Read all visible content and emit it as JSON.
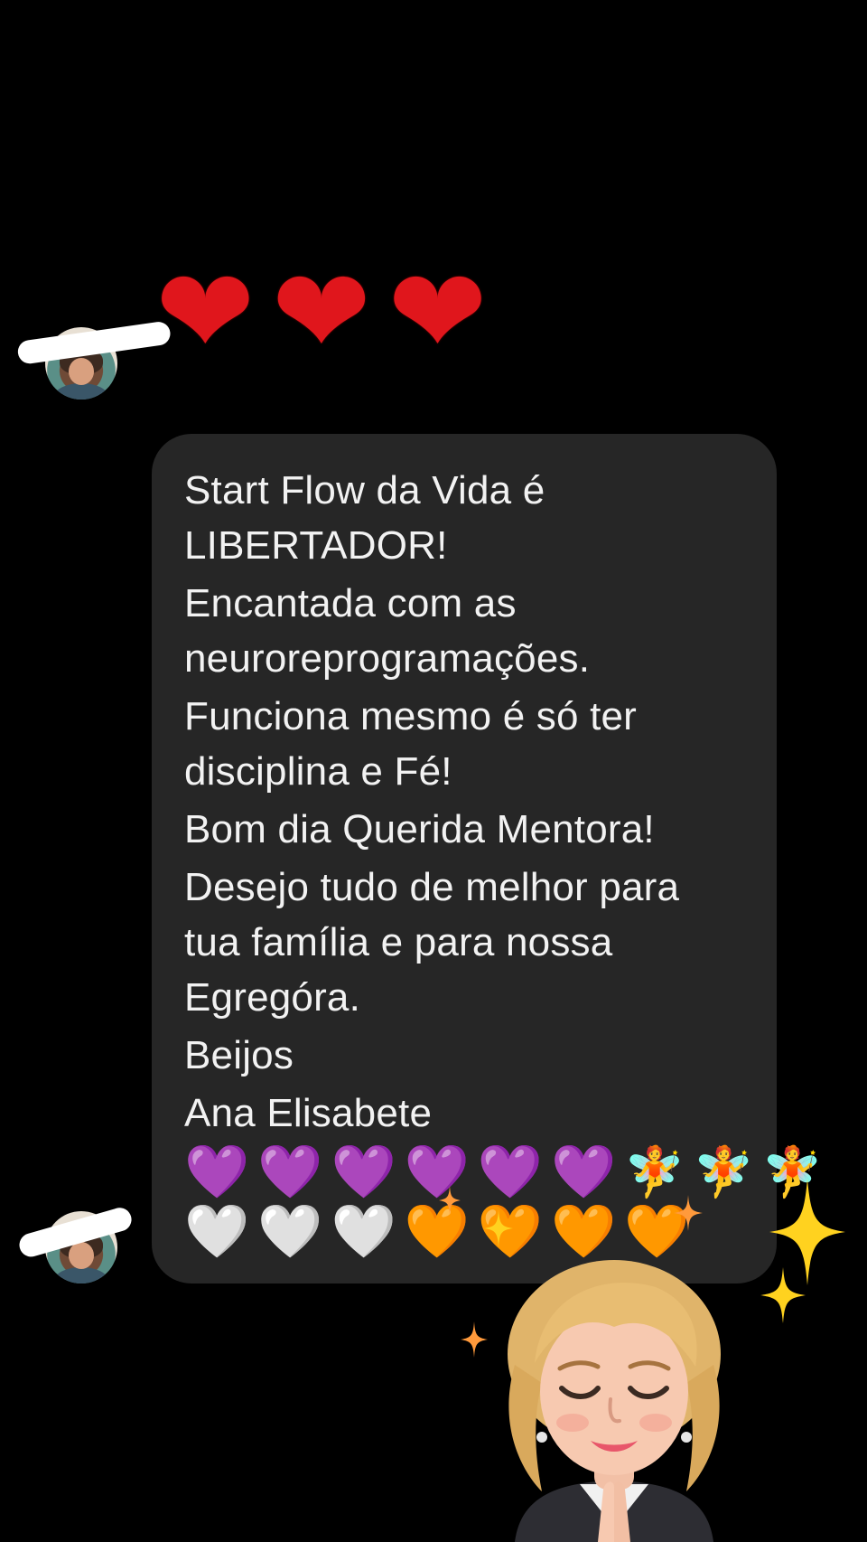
{
  "reaction": {
    "emoji": [
      "heart-icon",
      "heart-icon",
      "heart-icon"
    ],
    "glyph": "❤"
  },
  "message": {
    "paragraphs": [
      "Start Flow da Vida é\nLIBERTADOR!",
      "Encantada com as\nneuroreprogramações.",
      "Funciona mesmo é só ter\ndisciplina e Fé!",
      "Bom dia Querida Mentora!",
      "Desejo tudo de melhor para\ntua família e para nossa\nEgregóra.",
      "Beijos",
      "Ana Elisabete"
    ],
    "emoji_row_1": [
      "💜",
      "💜",
      "💜",
      "💜",
      "💜",
      "💜",
      "🧚",
      "🧚",
      "🧚"
    ],
    "emoji_row_2": [
      "🤍",
      "🤍",
      "🤍",
      "🧡",
      "🧡",
      "🧡",
      "🧡"
    ]
  },
  "colors": {
    "background": "#000000",
    "bubble": "#262626",
    "text": "#f2f2f2",
    "reaction_heart": "#e0161c",
    "sparkle_gold": "#ffd21f",
    "sparkle_orange": "#ff9a3c"
  },
  "sticker": {
    "icon": "memoji-sticker-icon"
  }
}
